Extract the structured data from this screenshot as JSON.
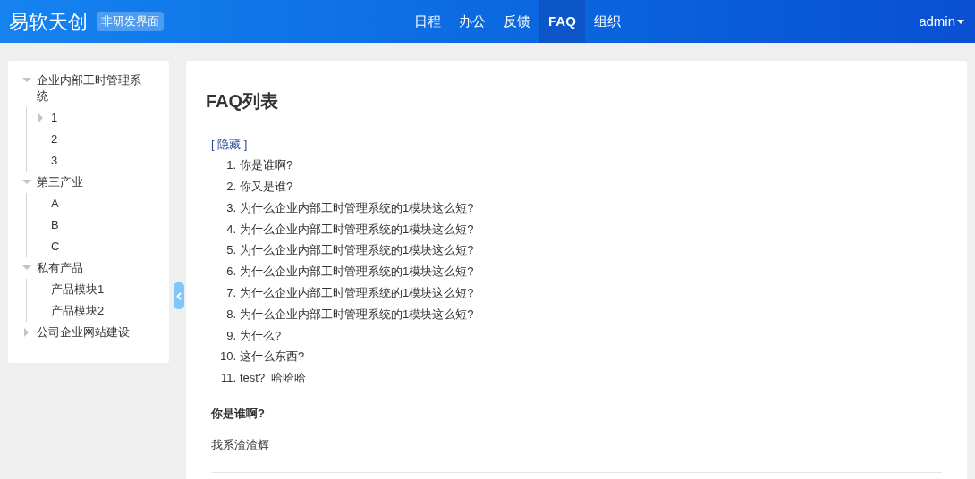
{
  "header": {
    "brand": "易软天创",
    "badge": "非研发界面",
    "nav": [
      {
        "label": "日程",
        "selected": false
      },
      {
        "label": "办公",
        "selected": false
      },
      {
        "label": "反馈",
        "selected": false
      },
      {
        "label": "FAQ",
        "selected": true
      },
      {
        "label": "组织",
        "selected": false
      }
    ],
    "user": "admin"
  },
  "sidebar": {
    "tree": [
      {
        "label": "企业内部工时管理系统",
        "expanded": true,
        "children": [
          {
            "label": "1",
            "expanded": false
          },
          {
            "label": "2"
          },
          {
            "label": "3"
          }
        ]
      },
      {
        "label": "第三产业",
        "expanded": true,
        "children": [
          {
            "label": "A"
          },
          {
            "label": "B"
          },
          {
            "label": "C"
          }
        ]
      },
      {
        "label": "私有产品",
        "expanded": true,
        "children": [
          {
            "label": "产品模块1"
          },
          {
            "label": "产品模块2"
          }
        ]
      },
      {
        "label": "公司企业网站建设",
        "expanded": false
      }
    ]
  },
  "main": {
    "title": "FAQ列表",
    "toggle": "[ 隐藏 ]",
    "questions": [
      {
        "number": "1.",
        "text": "你是谁啊?"
      },
      {
        "number": "2.",
        "text": "你又是谁?"
      },
      {
        "number": "3.",
        "text": "为什么企业内部工时管理系统的1模块这么短?"
      },
      {
        "number": "4.",
        "text": "为什么企业内部工时管理系统的1模块这么短?"
      },
      {
        "number": "5.",
        "text": "为什么企业内部工时管理系统的1模块这么短?"
      },
      {
        "number": "6.",
        "text": "为什么企业内部工时管理系统的1模块这么短?"
      },
      {
        "number": "7.",
        "text": "为什么企业内部工时管理系统的1模块这么短?"
      },
      {
        "number": "8.",
        "text": "为什么企业内部工时管理系统的1模块这么短?"
      },
      {
        "number": "9.",
        "text": "为什么?"
      },
      {
        "number": "10.",
        "text": "这什么东西?"
      },
      {
        "number": "11.",
        "text": "test?  哈哈哈"
      }
    ],
    "answer": {
      "question": "你是谁啊?",
      "text": "我系渣渣辉"
    }
  }
}
